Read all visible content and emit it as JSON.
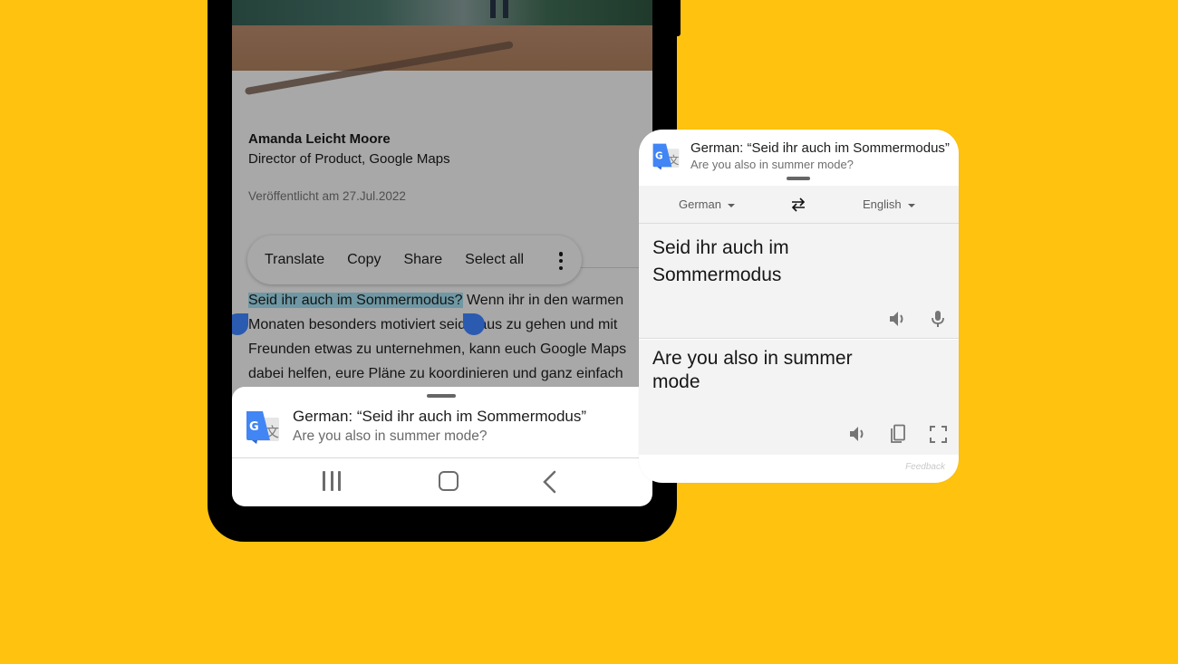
{
  "colors": {
    "background": "#FFC20E",
    "selection_highlight": "#6F98A4",
    "selection_handle": "#2B5BB0",
    "translate_blue": "#4285F4"
  },
  "article": {
    "hero_image_alt": "person-standing-on-red-rock-landscape",
    "author_name": "Amanda Leicht Moore",
    "author_title": "Director of Product, Google Maps",
    "published": "Veröffentlicht am 27.Jul.2022",
    "selected_text": "Seid ihr auch im Sommermodus?",
    "body_after_selection": " Wenn ihr in den warmen Monaten besonders motiviert seid, raus zu gehen und mit Freunden etwas zu unternehmen, kann euch Google Maps dabei helfen, eure Pläne zu koordinieren und ganz einfach"
  },
  "context_menu": {
    "items": [
      "Translate",
      "Copy",
      "Share",
      "Select all"
    ],
    "more_icon": "more-vert-icon"
  },
  "bottom_sheet": {
    "logo_icon": "google-translate-icon",
    "title": "German: “Seid ihr auch im Sommermodus”",
    "subtitle": "Are you also in summer mode?"
  },
  "nav_bar": {
    "recents_icon": "recents-icon",
    "home_icon": "home-icon",
    "back_icon": "back-icon"
  },
  "translate_card": {
    "logo_icon": "google-translate-icon",
    "title": "German: “Seid ihr auch im Sommermodus”",
    "subtitle": "Are you also in summer mode?",
    "source_language": "German",
    "target_language": "English",
    "swap_icon": "swap-languages-icon",
    "source_text": "Seid ihr auch im Sommermodus",
    "target_text": "Are you also in summer mode",
    "source_actions": [
      "speaker-icon",
      "microphone-icon"
    ],
    "target_actions": [
      "speaker-icon",
      "copy-icon",
      "fullscreen-icon"
    ],
    "feedback_label": "Feedback"
  }
}
